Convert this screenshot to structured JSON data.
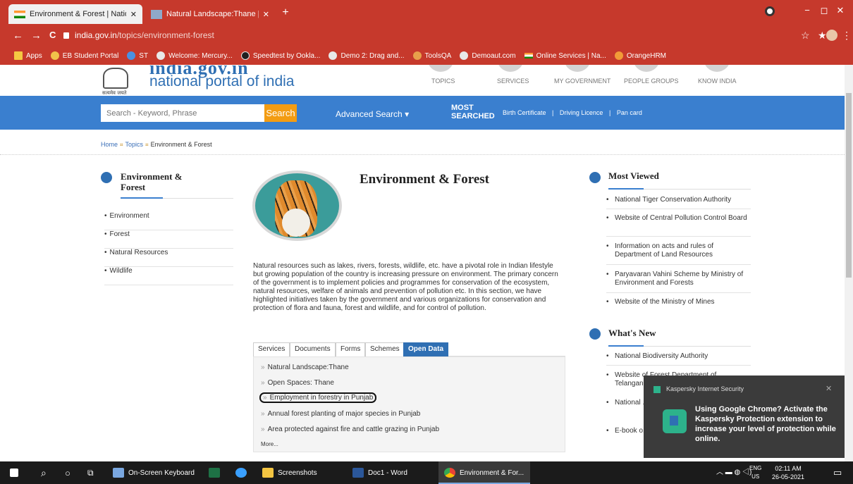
{
  "browser": {
    "tabs": [
      {
        "title": "Environment & Forest | National",
        "active": true
      },
      {
        "title": "Natural Landscape:Thane | smar",
        "active": false
      }
    ],
    "new_tab": "+",
    "url_host": "india.gov.in",
    "url_path": "/topics/environment-forest",
    "back": "←",
    "forward": "→",
    "reload": "C",
    "window_controls": {
      "minimize": "−",
      "maximize": "◻",
      "close": "✕"
    },
    "bookmarks": [
      {
        "label": "Apps",
        "icon": "apps-grid-icon"
      },
      {
        "label": "EB Student Portal",
        "icon": "portal-icon"
      },
      {
        "label": "ST",
        "icon": "st-icon"
      },
      {
        "label": "Welcome: Mercury...",
        "icon": "globe-icon"
      },
      {
        "label": "Speedtest by Ookla...",
        "icon": "speedtest-icon"
      },
      {
        "label": "Demo 2: Drag and...",
        "icon": "globe-icon"
      },
      {
        "label": "ToolsQA",
        "icon": "toolsqa-icon"
      },
      {
        "label": "Demoaut.com",
        "icon": "globe-icon"
      },
      {
        "label": "Online Services | Na...",
        "icon": "flag-icon"
      },
      {
        "label": "OrangeHRM",
        "icon": "orangehrm-icon"
      }
    ]
  },
  "site": {
    "logo_top": "india.gov.in",
    "logo_text": "national portal of india",
    "logo_sub": "सत्यमेव जयते",
    "topnav": [
      "TOPICS",
      "SERVICES",
      "MY GOVERNMENT",
      "PEOPLE GROUPS",
      "KNOW INDIA"
    ],
    "search_placeholder": "Search - Keyword, Phrase",
    "search_button": "Search",
    "advanced_search": "Advanced Search ▾",
    "most_searched_1": "MOST",
    "most_searched_2": "SEARCHED",
    "quick_links": [
      "Birth Certificate",
      "|",
      "Driving Licence",
      "|",
      "Pan card"
    ],
    "breadcrumb": [
      "Home",
      "Topics",
      "Environment & Forest"
    ],
    "breadcrumb_sep": "⌗"
  },
  "sidebar": {
    "title_1": "Environment &",
    "title_2": "Forest",
    "items": [
      "Environment",
      "Forest",
      "Natural Resources",
      "Wildlife"
    ]
  },
  "main": {
    "title": "Environment & Forest",
    "intro": "Natural resources such as lakes, rivers, forests, wildlife, etc. have a pivotal role in Indian lifestyle but growing population of the country is increasing pressure on environment. The primary concern of the government is to implement policies and programmes for conservation of the ecosystem, natural resources, welfare of animals and prevention of pollution etc. In this section, we have highlighted initiatives taken by the government and various organizations for conservation and protection of flora and fauna, forest and wildlife, and for control of pollution.",
    "tabs": [
      "Services",
      "Documents",
      "Forms",
      "Schemes",
      "Open Data"
    ],
    "active_tab": "Open Data",
    "open_data": [
      "Natural Landscape:Thane",
      "Open Spaces: Thane",
      "Employment in forestry in Punjab",
      "Annual forest planting of major species in Punjab",
      "Area protected against fire and cattle grazing in Punjab"
    ],
    "arrow": "»",
    "more": "More..."
  },
  "right": {
    "most_viewed_title": "Most Viewed",
    "most_viewed": [
      "National Tiger Conservation Authority",
      "Website of Central Pollution Control Board",
      "Information on acts and rules of Department of Land Resources",
      "Paryavaran Vahini Scheme by Ministry of Environment and Forests",
      "Website of the Ministry of Mines"
    ],
    "whats_new_title": "What's New",
    "whats_new": [
      "National Biodiversity Authority",
      "Website of Forest Department of Telangana",
      "National ... (CDM) Au...",
      "E-book o... River Dev... Rejuvena..."
    ]
  },
  "kaspersky": {
    "title": "Kaspersky Internet Security",
    "close": "✕",
    "message": "Using Google Chrome? Activate the Kaspersky Protection extension to increase your level of protection while online."
  },
  "taskbar": {
    "items": [
      "On-Screen Keyboard",
      "Screenshots",
      "Doc1 - Word",
      "Environment & For..."
    ],
    "lang_1": "ENG",
    "lang_2": "US",
    "time": "02:11 AM",
    "date": "26-05-2021"
  },
  "colors": {
    "chrome_red": "#c6392c",
    "site_blue": "#3a7fcf",
    "search_orange": "#f39c12",
    "kaspersky_green": "#2db28b"
  }
}
